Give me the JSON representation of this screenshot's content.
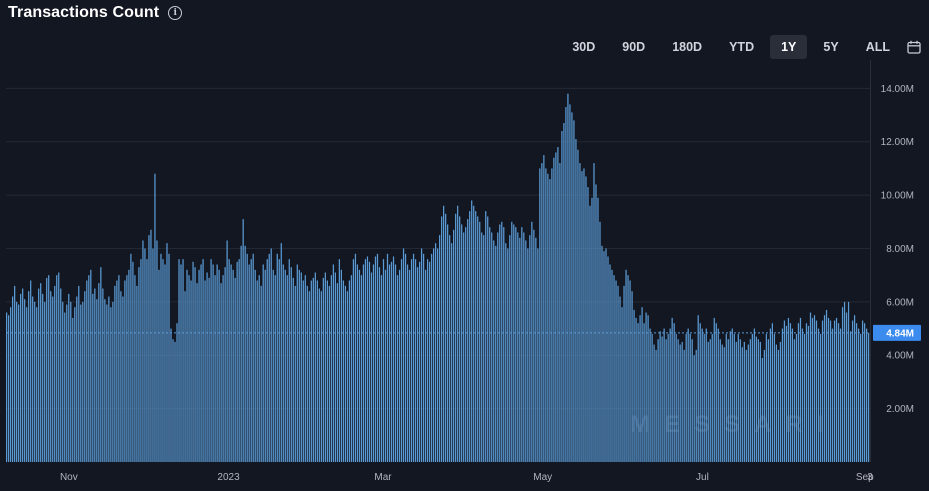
{
  "header": {
    "title": "Transactions Count",
    "info_icon": "info-icon"
  },
  "ranges": [
    {
      "label": "30D",
      "active": false
    },
    {
      "label": "90D",
      "active": false
    },
    {
      "label": "180D",
      "active": false
    },
    {
      "label": "YTD",
      "active": false
    },
    {
      "label": "1Y",
      "active": true
    },
    {
      "label": "5Y",
      "active": false
    },
    {
      "label": "ALL",
      "active": false
    }
  ],
  "calendar_icon": "calendar-icon",
  "watermark": "MESSARI",
  "colors": {
    "background": "#131722",
    "bar": "#5b9bd5",
    "last_value_bg": "#3c8cf0"
  },
  "chart_data": {
    "type": "bar",
    "title": "Transactions Count",
    "x_range": [
      "2022-10-08",
      "2023-09-03"
    ],
    "x_tick_labels": [
      {
        "label": "Nov",
        "date": "2022-11-01"
      },
      {
        "label": "2023",
        "date": "2023-01-01"
      },
      {
        "label": "Mar",
        "date": "2023-03-01"
      },
      {
        "label": "May",
        "date": "2023-05-01"
      },
      {
        "label": "Jul",
        "date": "2023-07-01"
      },
      {
        "label": "Sep",
        "date": "2023-09-01"
      },
      {
        "label": "3",
        "date": "2023-09-03"
      }
    ],
    "y_ticks": [
      {
        "value": 2000000,
        "label": "2.00M"
      },
      {
        "value": 4000000,
        "label": "4.00M"
      },
      {
        "value": 6000000,
        "label": "6.00M"
      },
      {
        "value": 8000000,
        "label": "8.00M"
      },
      {
        "value": 10000000,
        "label": "10.00M"
      },
      {
        "value": 12000000,
        "label": "12.00M"
      },
      {
        "value": 14000000,
        "label": "14.00M"
      }
    ],
    "ylim": [
      0,
      14500000
    ],
    "grid": true,
    "last_value": {
      "value": 4840000,
      "label": "4.84M"
    },
    "series": [
      {
        "unit": "millions",
        "values": [
          5.6,
          5.5,
          5.8,
          6.2,
          6.6,
          6.0,
          5.9,
          6.3,
          6.5,
          6.1,
          5.8,
          6.4,
          6.8,
          6.2,
          6.0,
          5.8,
          6.5,
          6.7,
          6.3,
          6.0,
          6.9,
          7.0,
          6.4,
          6.2,
          6.6,
          7.0,
          7.1,
          6.5,
          6.0,
          5.6,
          5.9,
          6.3,
          6.0,
          5.4,
          5.8,
          6.2,
          6.6,
          5.9,
          6.0,
          6.4,
          6.8,
          7.0,
          7.2,
          6.3,
          6.5,
          6.1,
          6.7,
          7.3,
          6.5,
          6.1,
          5.9,
          6.2,
          5.8,
          6.0,
          6.6,
          6.8,
          7.0,
          6.4,
          6.2,
          6.8,
          7.0,
          7.2,
          7.8,
          7.5,
          7.0,
          6.6,
          7.3,
          7.6,
          8.3,
          8.0,
          7.6,
          8.5,
          8.7,
          8.0,
          10.8,
          8.3,
          7.2,
          7.8,
          7.6,
          7.4,
          8.2,
          7.8,
          5.0,
          4.6,
          4.5,
          5.2,
          7.6,
          7.4,
          7.6,
          6.4,
          7.2,
          7.0,
          6.8,
          7.5,
          7.3,
          6.7,
          7.2,
          7.4,
          7.6,
          6.8,
          7.1,
          6.9,
          7.6,
          7.4,
          7.0,
          7.4,
          7.2,
          6.7,
          7.0,
          7.3,
          8.3,
          7.6,
          7.4,
          7.2,
          6.9,
          7.5,
          7.6,
          8.1,
          9.1,
          8.1,
          7.8,
          7.4,
          7.6,
          7.8,
          7.2,
          6.8,
          7.0,
          6.6,
          7.4,
          7.2,
          7.6,
          7.8,
          8.0,
          7.2,
          7.0,
          7.8,
          7.6,
          8.2,
          7.4,
          7.2,
          7.0,
          7.6,
          7.3,
          6.9,
          6.6,
          7.4,
          7.2,
          7.1,
          6.8,
          7.0,
          6.6,
          6.4,
          6.8,
          6.9,
          7.1,
          6.8,
          6.5,
          6.4,
          6.9,
          7.1,
          6.8,
          6.6,
          7.0,
          7.4,
          7.1,
          6.7,
          7.6,
          7.2,
          6.8,
          6.6,
          6.4,
          6.8,
          7.0,
          7.6,
          7.8,
          7.4,
          7.2,
          7.0,
          7.4,
          7.6,
          7.7,
          7.5,
          7.1,
          7.4,
          7.7,
          7.8,
          7.3,
          7.0,
          7.6,
          7.2,
          7.8,
          7.4,
          7.5,
          7.7,
          7.4,
          7.0,
          7.2,
          7.6,
          8.0,
          7.8,
          7.4,
          7.2,
          7.6,
          7.8,
          7.6,
          7.3,
          7.5,
          8.0,
          7.8,
          7.2,
          7.6,
          7.5,
          7.8,
          8.0,
          8.2,
          8.0,
          8.5,
          9.2,
          9.6,
          9.3,
          8.9,
          8.5,
          8.2,
          8.7,
          9.3,
          9.6,
          9.2,
          8.9,
          8.6,
          8.8,
          9.1,
          9.4,
          9.8,
          9.6,
          9.4,
          9.2,
          9.0,
          8.6,
          8.5,
          9.4,
          9.2,
          8.8,
          8.6,
          8.3,
          8.1,
          8.6,
          8.9,
          9.0,
          8.8,
          8.2,
          8.0,
          8.5,
          9.0,
          8.9,
          8.8,
          8.6,
          8.4,
          8.8,
          8.6,
          8.3,
          8.0,
          8.5,
          9.0,
          8.7,
          8.4,
          8.0,
          11.0,
          11.2,
          11.5,
          11.0,
          10.8,
          10.6,
          11.0,
          11.4,
          11.6,
          11.8,
          11.2,
          12.4,
          12.7,
          13.3,
          13.8,
          13.4,
          13.1,
          12.8,
          12.1,
          11.7,
          11.2,
          10.9,
          11.0,
          10.7,
          10.3,
          9.6,
          9.9,
          11.2,
          10.4,
          9.9,
          9.0,
          8.1,
          7.9,
          8.0,
          7.7,
          7.4,
          7.2,
          7.0,
          6.8,
          6.6,
          6.2,
          5.8,
          6.6,
          7.2,
          7.0,
          6.8,
          6.4,
          5.7,
          5.4,
          5.2,
          5.5,
          5.8,
          5.2,
          5.6,
          5.5,
          5.0,
          4.8,
          4.4,
          4.2,
          4.6,
          4.9,
          4.7,
          5.0,
          4.6,
          4.8,
          5.0,
          5.4,
          5.2,
          4.8,
          4.6,
          4.4,
          4.5,
          4.2,
          4.8,
          5.0,
          4.8,
          4.6,
          4.0,
          4.2,
          5.5,
          5.2,
          5.0,
          4.8,
          5.0,
          4.5,
          4.6,
          4.8,
          5.4,
          5.2,
          5.0,
          4.6,
          4.4,
          4.3,
          4.8,
          4.6,
          4.9,
          5.0,
          4.8,
          4.5,
          4.8,
          4.6,
          4.3,
          4.5,
          4.2,
          4.4,
          4.6,
          4.8,
          5.0,
          4.7,
          4.6,
          4.5,
          3.9,
          4.2,
          4.8,
          4.6,
          5.0,
          5.2,
          4.8,
          4.4,
          4.2,
          4.5,
          5.0,
          5.3,
          5.1,
          5.4,
          5.2,
          5.0,
          4.6,
          4.8,
          5.2,
          5.4,
          5.0,
          4.8,
          5.2,
          5.1,
          5.6,
          5.4,
          5.5,
          5.3,
          5.0,
          4.8,
          5.3,
          5.5,
          5.7,
          5.4,
          5.3,
          5.0,
          5.3,
          5.4,
          5.2,
          5.0,
          5.8,
          6.0,
          5.6,
          6.0,
          4.9,
          5.3,
          5.5,
          5.2,
          5.0,
          4.8,
          5.3,
          5.2,
          5.0,
          4.84
        ]
      }
    ]
  }
}
